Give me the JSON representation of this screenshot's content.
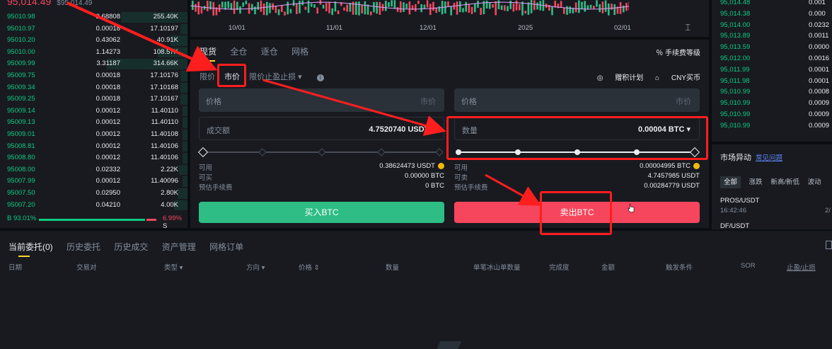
{
  "orderbook": {
    "header_price": "95,014.49",
    "header_sub": "$95,014.49",
    "rows": [
      {
        "price": "95010.98",
        "qty": "2.68808",
        "total": "255.40K"
      },
      {
        "price": "95010.97",
        "qty": "0.00018",
        "total": "17.10197"
      },
      {
        "price": "95010.20",
        "qty": "0.43062",
        "total": "40.91K"
      },
      {
        "price": "95010.00",
        "qty": "1.14273",
        "total": "108.57K"
      },
      {
        "price": "95009.99",
        "qty": "3.31187",
        "total": "314.66K"
      },
      {
        "price": "95009.75",
        "qty": "0.00018",
        "total": "17.10176"
      },
      {
        "price": "95009.34",
        "qty": "0.00018",
        "total": "17.10168"
      },
      {
        "price": "95009.25",
        "qty": "0.00018",
        "total": "17.10167"
      },
      {
        "price": "95009.14",
        "qty": "0.00012",
        "total": "11.40110"
      },
      {
        "price": "95009.13",
        "qty": "0.00012",
        "total": "11.40110"
      },
      {
        "price": "95009.01",
        "qty": "0.00012",
        "total": "11.40108"
      },
      {
        "price": "95008.81",
        "qty": "0.00012",
        "total": "11.40106"
      },
      {
        "price": "95008.80",
        "qty": "0.00012",
        "total": "11.40106"
      },
      {
        "price": "95008.00",
        "qty": "0.02332",
        "total": "2.22K"
      },
      {
        "price": "95007.99",
        "qty": "0.00012",
        "total": "11.40096"
      },
      {
        "price": "95007.50",
        "qty": "0.02950",
        "total": "2.80K"
      },
      {
        "price": "95007.20",
        "qty": "0.04210",
        "total": "4.00K"
      }
    ],
    "buy_pct": "B 93.01%",
    "sell_pct": "6.99%",
    "sell_letter": "S"
  },
  "chart": {
    "dates": [
      "10/01",
      "11/01",
      "12/01",
      "2025",
      "02/01"
    ],
    "reset_icon": "⌶"
  },
  "trade": {
    "tabs": [
      "现货",
      "全仓",
      "逐仓",
      "网格"
    ],
    "fee_link": "手续费等级",
    "order_types": [
      "限价",
      "市价",
      "限价止盈止损 ▾"
    ],
    "right_links": [
      "赠积计划",
      "CNY买币"
    ],
    "buy_price_label": "价格",
    "buy_price_unit": "市价",
    "sell_price_label": "价格",
    "sell_price_unit": "市价",
    "buy_amount_label": "成交额",
    "buy_amount_value": "4.7520740  USDT ▾",
    "sell_amount_label": "数量",
    "sell_amount_value": "0.00004  BTC ▾",
    "buy_info": [
      {
        "label": "可用",
        "value": "0.38624473 USDT"
      },
      {
        "label": "可买",
        "value": "0.00000 BTC"
      },
      {
        "label": "预估手续费",
        "value": "0 BTC"
      }
    ],
    "sell_info": [
      {
        "label": "可用",
        "value": "0.00004995 BTC"
      },
      {
        "label": "可卖",
        "value": "4.7457985 USDT"
      },
      {
        "label": "预估手续费",
        "value": "0.00284779 USDT"
      }
    ],
    "buy_button": "买入BTC",
    "sell_button": "卖出BTC"
  },
  "right_book": {
    "rows": [
      {
        "price": "95,014.48",
        "qty": "0.001"
      },
      {
        "price": "95,014.38",
        "qty": "0.000"
      },
      {
        "price": "95,014.00",
        "qty": "0.0232"
      },
      {
        "price": "95,013.89",
        "qty": "0.0011"
      },
      {
        "price": "95,013.59",
        "qty": "0.0000"
      },
      {
        "price": "95,012.00",
        "qty": "0.0016"
      },
      {
        "price": "95,011.99",
        "qty": "0.0001"
      },
      {
        "price": "95,011.98",
        "qty": "0.0001"
      },
      {
        "price": "95,010.99",
        "qty": "0.0008"
      },
      {
        "price": "95,010.99",
        "qty": "0.0009"
      },
      {
        "price": "95,010.99",
        "qty": "0.0009"
      },
      {
        "price": "95,010.99",
        "qty": "0.0009"
      }
    ]
  },
  "market": {
    "title": "市场异动",
    "help": "常见问题",
    "chips": [
      "全部",
      "涨跌",
      "新高/新低",
      "波动"
    ],
    "item1_symbol": "PROS/USDT",
    "item1_time": "16:42:46",
    "item1_extra": "2/",
    "item2_symbol": "DF/USDT"
  },
  "orders": {
    "tabs": [
      "当前委托(0)",
      "历史委托",
      "历史成交",
      "资产管理",
      "网格订单"
    ],
    "columns": [
      "日期",
      "交易对",
      "类型 ▾",
      "方向 ▾",
      "价格 ⇕",
      "数量",
      "单笔冰山单数量",
      "完成度",
      "金额",
      "触发条件",
      "SOR",
      "止盈/止损"
    ]
  },
  "colors": {
    "buy": "#2ebd85",
    "sell": "#f6465d",
    "accent": "#fcd535",
    "annotation": "#ff1e1e"
  }
}
